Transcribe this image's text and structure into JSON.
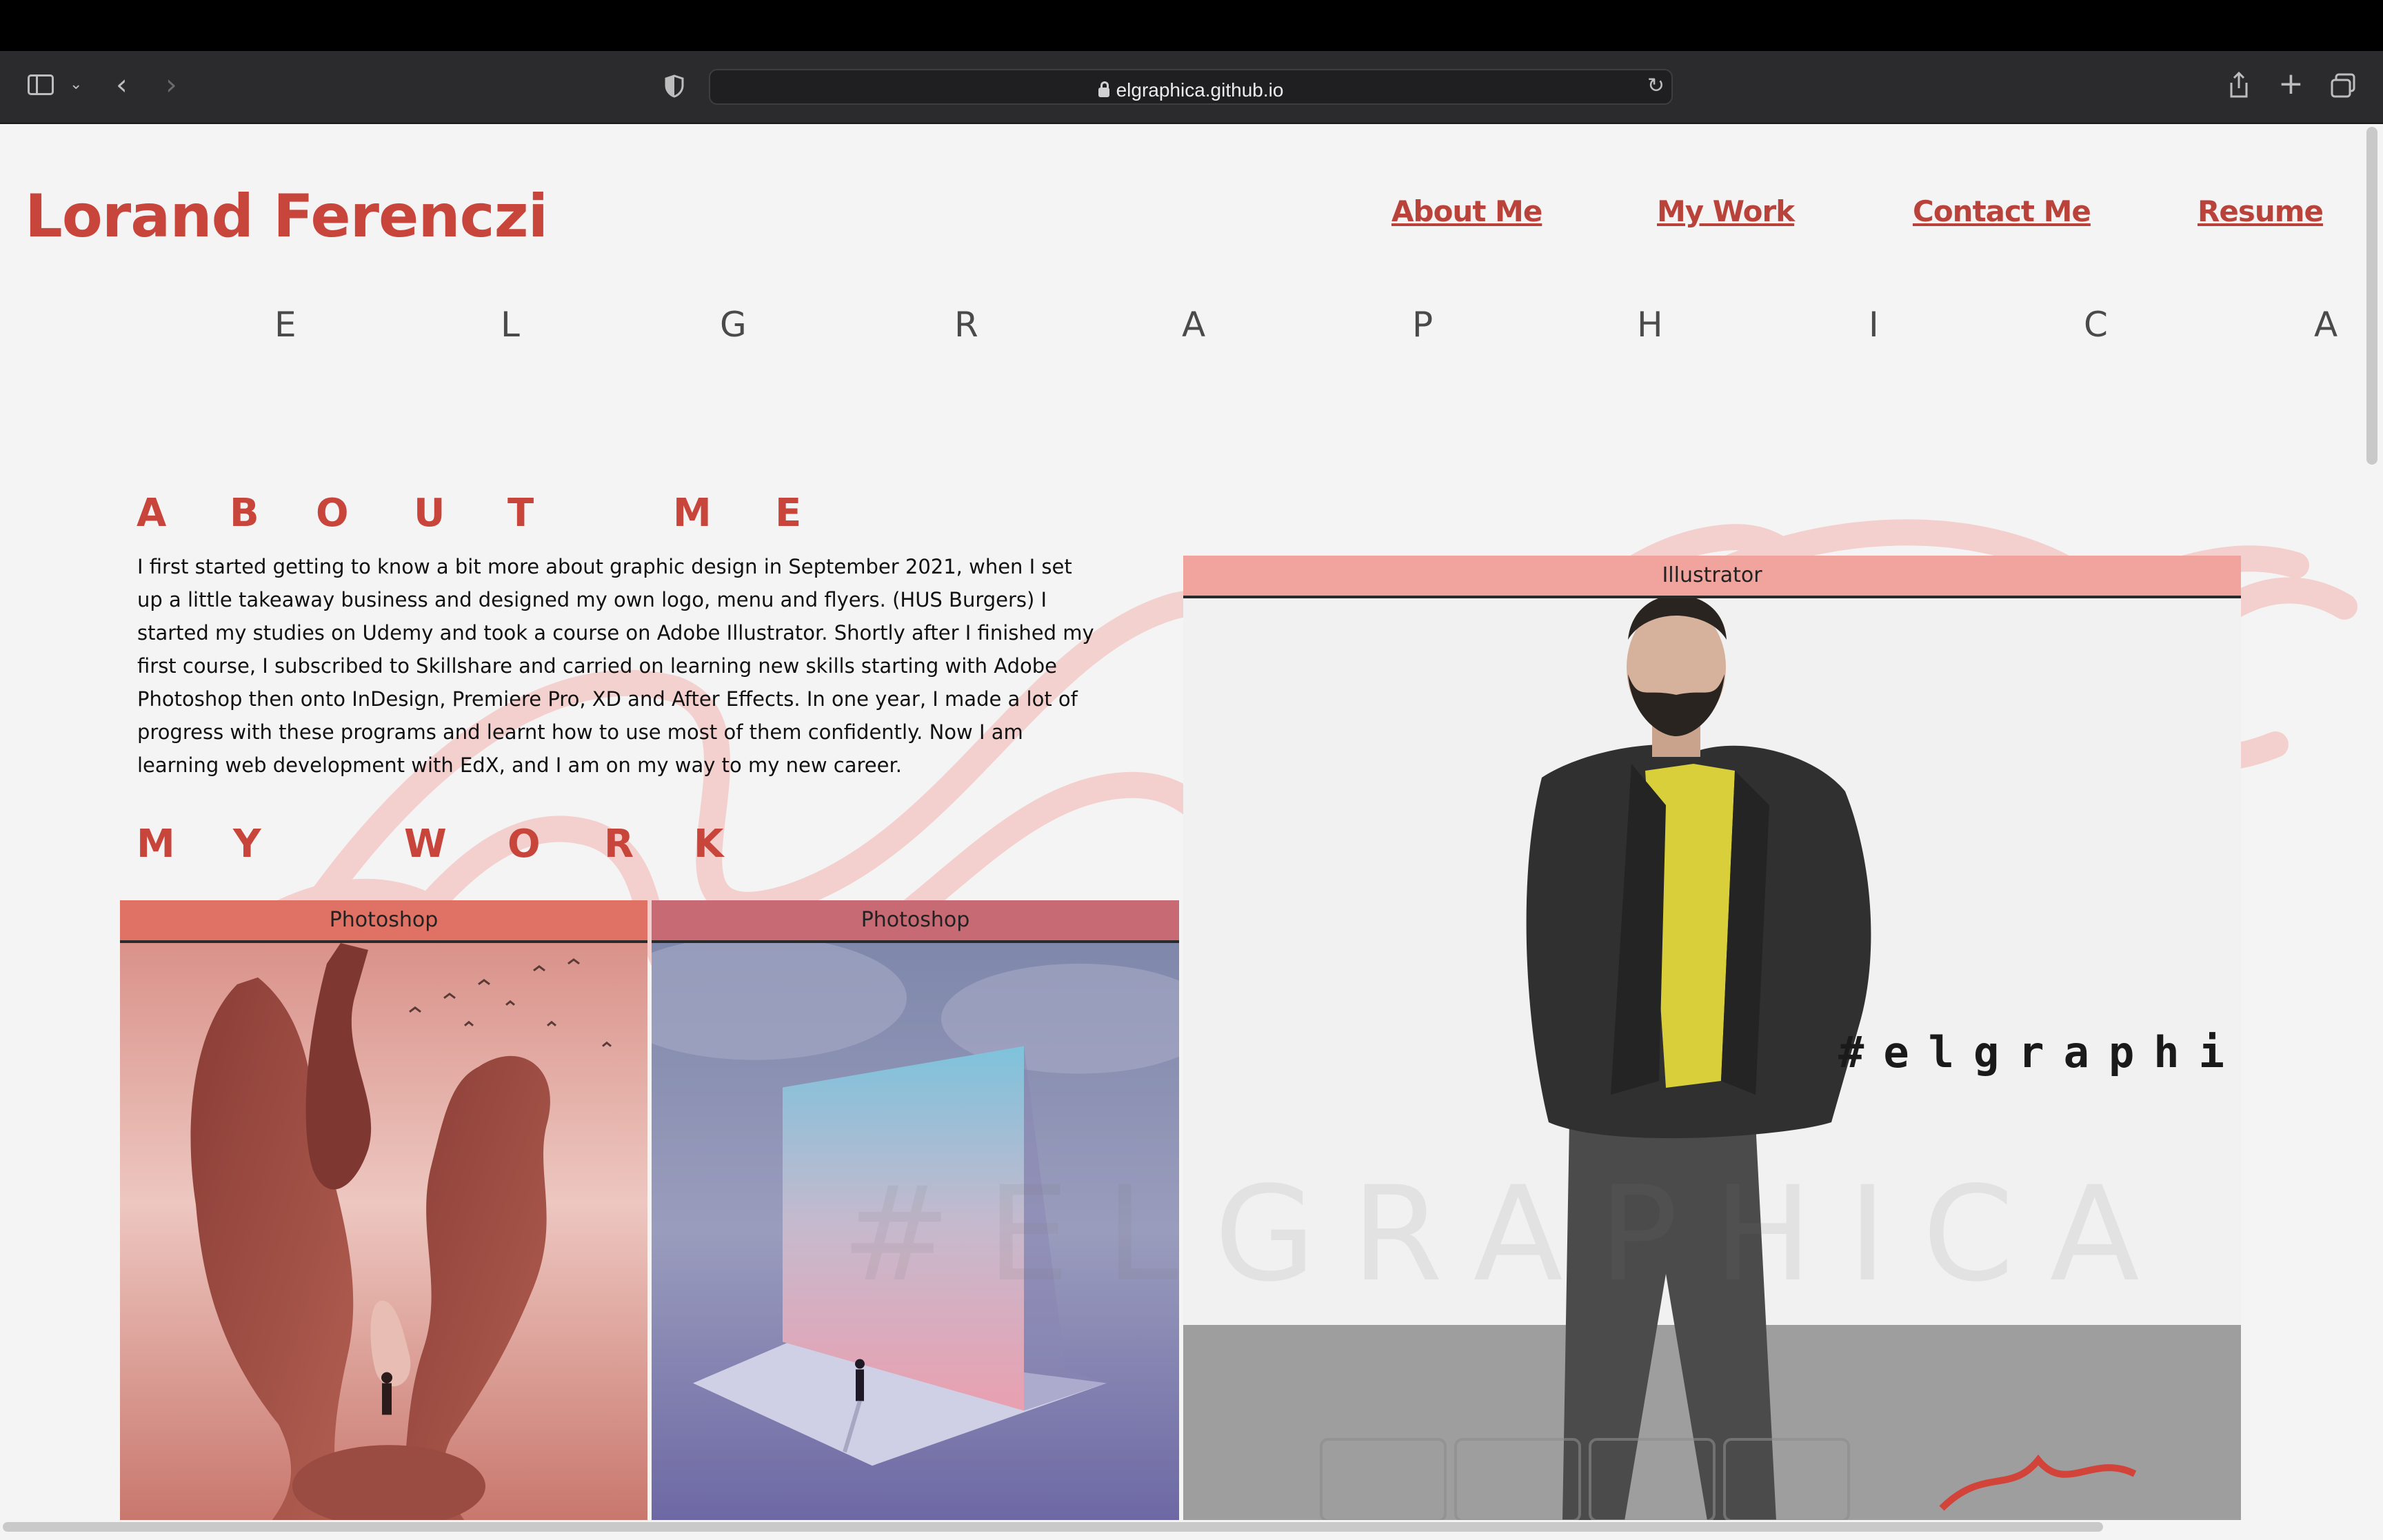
{
  "browser": {
    "url": "elgraphica.github.io",
    "icons": [
      "sidebar-icon",
      "chevron-down-icon",
      "back-icon",
      "forward-icon",
      "shield-icon",
      "lock-icon",
      "reload-icon",
      "share-icon",
      "new-tab-icon",
      "tabs-overview-icon"
    ]
  },
  "site": {
    "logo": "Lorand Ferenczi",
    "nav": [
      "About Me",
      "My Work",
      "Contact Me",
      "Resume"
    ],
    "tagline": [
      "E",
      "L",
      "G",
      "R",
      "A",
      "P",
      "H",
      "I",
      "C",
      "A"
    ]
  },
  "about": {
    "title": [
      "A",
      "B",
      "O",
      "U",
      "T",
      "M",
      "E"
    ],
    "text": "I first started getting to know a bit more about graphic design in September 2021, when I set up a little takeaway business and designed my own logo, menu and flyers. (HUS Burgers) I started my studies on Udemy and took a course on Adobe Illustrator. Shortly after I finished my first course, I subscribed to Skillshare and carried on learning new skills starting with Adobe Photoshop then onto InDesign, Premiere Pro, XD and After Effects. In one year, I made a lot of progress with these programs and learnt how to use most of them confidently. Now I am learning web development with EdX, and I am on my way to my new career."
  },
  "work": {
    "title": [
      "M",
      "Y",
      "W",
      "O",
      "R",
      "K"
    ],
    "cards": [
      {
        "label": "Photoshop"
      },
      {
        "label": "Photoshop"
      },
      {
        "label": "Illustrator",
        "overlay_text": "#elgraphica"
      }
    ]
  },
  "watermark": "#ELGRAPHICA",
  "colors": {
    "accent": "#c8453b",
    "label_bg": "#f0a49d"
  }
}
